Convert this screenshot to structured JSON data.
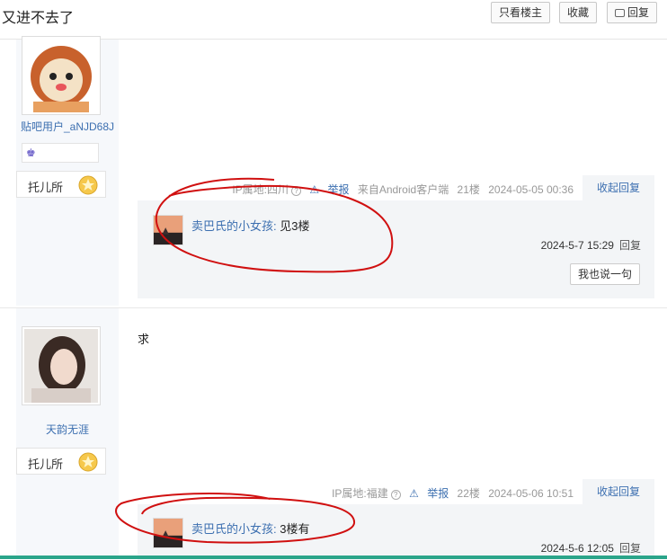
{
  "header": {
    "title": "又进不去了",
    "only_op_label": "只看楼主",
    "favorite_label": "收藏",
    "reply_label": "回复"
  },
  "posts": [
    {
      "username": "贴吧用户_aNJD68J",
      "badge_name": "托儿所",
      "content": "",
      "ip": "IP属地:四川",
      "report": "举报",
      "client": "来自Android客户端",
      "floor": "21楼",
      "time": "2024-05-05 00:36",
      "fold_label": "收起回复",
      "replies": [
        {
          "user": "卖巴氏的小女孩:",
          "text": "见3楼",
          "time": "2024-5-7 15:29",
          "reply_btn": "回复"
        }
      ],
      "say_label": "我也说一句"
    },
    {
      "username": "天韵无涯",
      "badge_name": "托儿所",
      "content": "求",
      "ip": "IP属地:福建",
      "report": "举报",
      "floor": "22楼",
      "time": "2024-05-06 10:51",
      "fold_label": "收起回复",
      "replies": [
        {
          "user": "卖巴氏的小女孩:",
          "text": "3楼有",
          "time": "2024-5-6 12:05",
          "reply_btn": "回复"
        }
      ]
    }
  ],
  "colors": {
    "link": "#3c6fb0",
    "annotation": "#d01010",
    "panel": "#f3f5f7"
  }
}
